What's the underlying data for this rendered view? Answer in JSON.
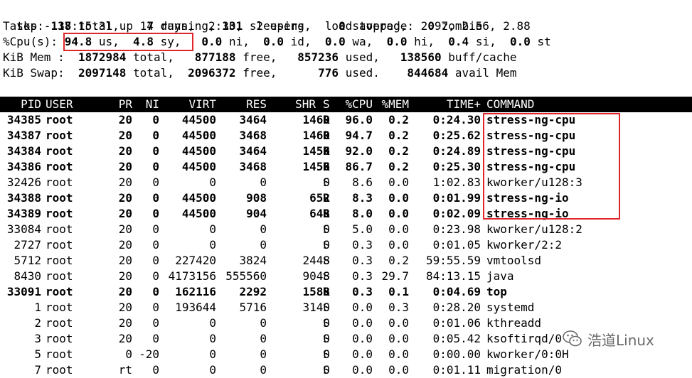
{
  "summary": {
    "uptime_line": "top - 17:15:31 up 14 days,  2:30,  2 users,  load average: 2.97, 2.56, 2.88",
    "tasks": {
      "label": "Tasks:",
      "total": "138",
      "total_label": "total,",
      "running": "7",
      "running_label": "running,",
      "sleeping": "131",
      "sleeping_label": "sleeping,",
      "stopped": "0",
      "stopped_label": "stopped,",
      "zombie": "0",
      "zombie_label": "zombie"
    },
    "cpu": {
      "label": "%Cpu(s):",
      "us": "94.8",
      "us_label": "us,",
      "sy": "4.8",
      "sy_label": "sy,",
      "ni": "0.0",
      "ni_label": "ni,",
      "id": "0.0",
      "id_label": "id,",
      "wa": "0.0",
      "wa_label": "wa,",
      "hi": "0.0",
      "hi_label": "hi,",
      "si": "0.4",
      "si_label": "si,",
      "st": "0.0",
      "st_label": "st"
    },
    "mem": {
      "label": "KiB Mem :",
      "total": "1872984",
      "total_label": "total,",
      "free": "877188",
      "free_label": "free,",
      "used": "857236",
      "used_label": "used,",
      "buff": "138560",
      "buff_label": "buff/cache"
    },
    "swap": {
      "label": "KiB Swap:",
      "total": "2097148",
      "total_label": "total,",
      "free": "2096372",
      "free_label": "free,",
      "used": "776",
      "used_label": "used.",
      "avail": "844684",
      "avail_label": "avail Mem"
    }
  },
  "table": {
    "headers": {
      "pid": "PID",
      "user": "USER",
      "pr": "PR",
      "ni": "NI",
      "virt": "VIRT",
      "res": "RES",
      "shr": "SHR",
      "s": "S",
      "cpu": "%CPU",
      "mem": "%MEM",
      "time": "TIME+",
      "command": "COMMAND"
    },
    "rows": [
      {
        "bold": true,
        "pid": "34385",
        "user": "root",
        "pr": "20",
        "ni": "0",
        "virt": "44500",
        "res": "3464",
        "shr": "1460",
        "s": "R",
        "cpu": "96.0",
        "mem": "0.2",
        "time": "0:24.30",
        "command": "stress-ng-cpu"
      },
      {
        "bold": true,
        "pid": "34387",
        "user": "root",
        "pr": "20",
        "ni": "0",
        "virt": "44500",
        "res": "3468",
        "shr": "1460",
        "s": "R",
        "cpu": "94.7",
        "mem": "0.2",
        "time": "0:25.62",
        "command": "stress-ng-cpu"
      },
      {
        "bold": true,
        "pid": "34384",
        "user": "root",
        "pr": "20",
        "ni": "0",
        "virt": "44500",
        "res": "3464",
        "shr": "1456",
        "s": "R",
        "cpu": "92.0",
        "mem": "0.2",
        "time": "0:24.89",
        "command": "stress-ng-cpu"
      },
      {
        "bold": true,
        "pid": "34386",
        "user": "root",
        "pr": "20",
        "ni": "0",
        "virt": "44500",
        "res": "3468",
        "shr": "1456",
        "s": "R",
        "cpu": "86.7",
        "mem": "0.2",
        "time": "0:25.30",
        "command": "stress-ng-cpu"
      },
      {
        "bold": false,
        "pid": "32426",
        "user": "root",
        "pr": "20",
        "ni": "0",
        "virt": "0",
        "res": "0",
        "shr": "0",
        "s": "S",
        "cpu": "8.6",
        "mem": "0.0",
        "time": "1:02.83",
        "command": "kworker/u128:3"
      },
      {
        "bold": true,
        "pid": "34388",
        "user": "root",
        "pr": "20",
        "ni": "0",
        "virt": "44500",
        "res": "908",
        "shr": "652",
        "s": "R",
        "cpu": "8.3",
        "mem": "0.0",
        "time": "0:01.99",
        "command": "stress-ng-io"
      },
      {
        "bold": true,
        "pid": "34389",
        "user": "root",
        "pr": "20",
        "ni": "0",
        "virt": "44500",
        "res": "904",
        "shr": "648",
        "s": "R",
        "cpu": "8.0",
        "mem": "0.0",
        "time": "0:02.09",
        "command": "stress-ng-io"
      },
      {
        "bold": false,
        "pid": "33084",
        "user": "root",
        "pr": "20",
        "ni": "0",
        "virt": "0",
        "res": "0",
        "shr": "0",
        "s": "S",
        "cpu": "5.0",
        "mem": "0.0",
        "time": "0:23.98",
        "command": "kworker/u128:2"
      },
      {
        "bold": false,
        "pid": "2727",
        "user": "root",
        "pr": "20",
        "ni": "0",
        "virt": "0",
        "res": "0",
        "shr": "0",
        "s": "S",
        "cpu": "0.3",
        "mem": "0.0",
        "time": "0:01.05",
        "command": "kworker/2:2"
      },
      {
        "bold": false,
        "pid": "5712",
        "user": "root",
        "pr": "20",
        "ni": "0",
        "virt": "227420",
        "res": "3824",
        "shr": "2448",
        "s": "S",
        "cpu": "0.3",
        "mem": "0.2",
        "time": "59:55.59",
        "command": "vmtoolsd"
      },
      {
        "bold": false,
        "pid": "8430",
        "user": "root",
        "pr": "20",
        "ni": "0",
        "virt": "4173156",
        "res": "555560",
        "shr": "9048",
        "s": "S",
        "cpu": "0.3",
        "mem": "29.7",
        "time": "84:13.15",
        "command": "java"
      },
      {
        "bold": true,
        "pid": "33091",
        "user": "root",
        "pr": "20",
        "ni": "0",
        "virt": "162116",
        "res": "2292",
        "shr": "1588",
        "s": "R",
        "cpu": "0.3",
        "mem": "0.1",
        "time": "0:04.69",
        "command": "top"
      },
      {
        "bold": false,
        "pid": "1",
        "user": "root",
        "pr": "20",
        "ni": "0",
        "virt": "193644",
        "res": "5716",
        "shr": "3140",
        "s": "S",
        "cpu": "0.0",
        "mem": "0.3",
        "time": "0:28.20",
        "command": "systemd"
      },
      {
        "bold": false,
        "pid": "2",
        "user": "root",
        "pr": "20",
        "ni": "0",
        "virt": "0",
        "res": "0",
        "shr": "0",
        "s": "S",
        "cpu": "0.0",
        "mem": "0.0",
        "time": "0:01.06",
        "command": "kthreadd"
      },
      {
        "bold": false,
        "pid": "3",
        "user": "root",
        "pr": "20",
        "ni": "0",
        "virt": "0",
        "res": "0",
        "shr": "0",
        "s": "S",
        "cpu": "0.0",
        "mem": "0.0",
        "time": "0:05.42",
        "command": "ksoftirqd/0"
      },
      {
        "bold": false,
        "pid": "5",
        "user": "root",
        "pr": "0",
        "ni": "-20",
        "virt": "0",
        "res": "0",
        "shr": "0",
        "s": "S",
        "cpu": "0.0",
        "mem": "0.0",
        "time": "0:00.00",
        "command": "kworker/0:0H"
      },
      {
        "bold": false,
        "pid": "7",
        "user": "root",
        "pr": "rt",
        "ni": "0",
        "virt": "0",
        "res": "0",
        "shr": "0",
        "s": "S",
        "cpu": "0.0",
        "mem": "0.0",
        "time": "0:01.11",
        "command": "migration/0"
      }
    ]
  },
  "highlight_color": "#e0262a",
  "watermark": {
    "text": "浩道Linux",
    "icon": "wechat-icon"
  }
}
